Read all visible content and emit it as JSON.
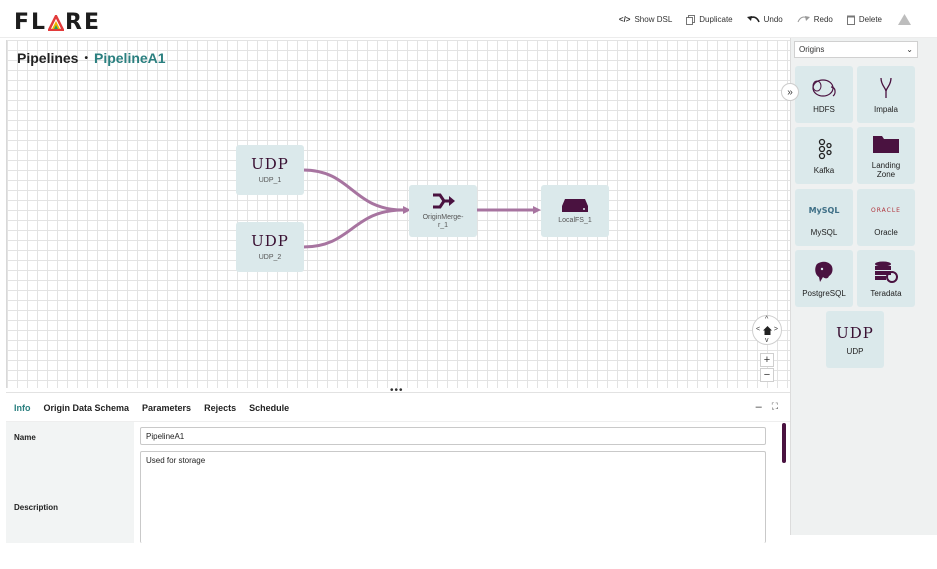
{
  "app": {
    "logo_text_left": "FL",
    "logo_text_right": "RE",
    "logo_tri_colors": [
      "#e23b3b",
      "#f0b400",
      "#2b9d5b"
    ]
  },
  "toolbar": {
    "show_dsl": "Show DSL",
    "duplicate": "Duplicate",
    "undo": "Undo",
    "redo": "Redo",
    "delete": "Delete"
  },
  "breadcrumb": {
    "root": "Pipelines",
    "separator": "•",
    "current": "PipelineA1"
  },
  "canvas": {
    "nodes": {
      "udp1": {
        "title": "UDP",
        "label": "UDP_1"
      },
      "udp2": {
        "title": "UDP",
        "label": "UDP_2"
      },
      "merge": {
        "label": "OriginMerge-r_1"
      },
      "localfs": {
        "label": "LocalFS_1"
      }
    },
    "edge_color": "#a774a0",
    "node_color": "#dbe9eb"
  },
  "bottom_panel": {
    "drag_handle": "•••",
    "tabs": [
      "Info",
      "Origin Data Schema",
      "Parameters",
      "Rejects",
      "Schedule"
    ],
    "active_tab": "Info",
    "minimize": "–",
    "expand": "⛶",
    "fields": {
      "name_label": "Name",
      "name_value": "PipelineA1",
      "description_label": "Description",
      "description_value": "Used for storage"
    }
  },
  "sidebar": {
    "collapse": "»",
    "dropdown_value": "Origins",
    "tiles": {
      "hdfs": "HDFS",
      "impala": "Impala",
      "kafka": "Kafka",
      "landing_zone": "Landing Zone",
      "mysql": "MySQL",
      "mysql_logo": "MySQL",
      "oracle": "Oracle",
      "oracle_logo": "ORACLE",
      "postgresql": "PostgreSQL",
      "teradata": "Teradata",
      "udp": "UDP",
      "udp_title": "UDP"
    }
  },
  "colors": {
    "accent": "#2a7f7f",
    "brand_dark": "#4a1240"
  }
}
